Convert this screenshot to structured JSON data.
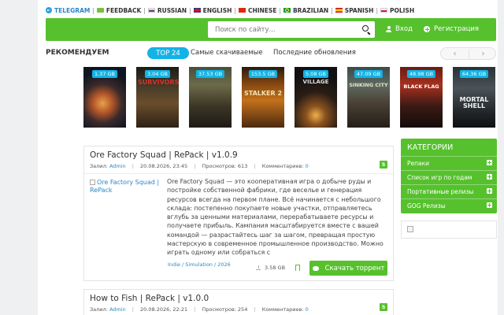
{
  "langbar": {
    "items": [
      {
        "label": "TELEGRAM",
        "icon": "telegram-icon"
      },
      {
        "label": "FEEDBACK",
        "icon": "feedback-icon"
      },
      {
        "label": "RUSSIAN",
        "flag": "ru"
      },
      {
        "label": "ENGLISH",
        "flag": "uk"
      },
      {
        "label": "CHINESE",
        "flag": "cn"
      },
      {
        "label": "BRAZILIAN",
        "flag": "br"
      },
      {
        "label": "SPANISH",
        "flag": "es"
      },
      {
        "label": "POLISH",
        "flag": "pl"
      }
    ],
    "separator": "|"
  },
  "header": {
    "search_placeholder": "Поиск по сайту...",
    "login_label": "Вход",
    "register_label": "Регистрация"
  },
  "recommend": {
    "title": "РЕКОМЕНДУЕМ",
    "tabs": [
      "TOP 24",
      "Самые скачиваемые",
      "Последние обновления"
    ],
    "prev_arrow": "‹",
    "next_arrow": "›"
  },
  "covers": [
    {
      "size": "1.37 GB",
      "title": ""
    },
    {
      "size": "3.04 GB",
      "title": "SURVIVORS"
    },
    {
      "size": "37.53 GB",
      "title": ""
    },
    {
      "size": "153.5 GB",
      "title": "STALKER 2"
    },
    {
      "size": "5.08 GB",
      "title": "VILLAGE"
    },
    {
      "size": "47.09 GB",
      "title": "SINKING CITY"
    },
    {
      "size": "48.98 GB",
      "title": "BLACK FLAG"
    },
    {
      "size": "64.36 GB",
      "title": "MORTAL SHELL"
    }
  ],
  "posts": [
    {
      "title": "Ore Factory Squad | RePack | v1.0.9",
      "badge": "5",
      "meta": {
        "upload_label": "Залил:",
        "uploader": "Admin",
        "date": "20.08.2026, 23:45",
        "views_label": "Просмотров:",
        "views": "613",
        "comments_label": "Комментариев:",
        "comments": "0"
      },
      "image_alt": "Ore Factory Squad | RePack",
      "description": "Ore Factory Squad — это кооперативная игра о добыче руды и постройке собственной фабрики, где веселье и генерация ресурсов всегда на первом плане. Всё начинается с небольшого склада: постепенно покупаете новые участки, отправляетесь вглубь за ценными материалами, перерабатываете ресурсы и получаете прибыль. Кампания масштабируется вместе с вашей командой — разрастайтесь шаг за шагом, превращая простую мастерскую в современное промышленное производство. Можно играть одному или собраться с",
      "tags": "Indie / Simulation / 2026",
      "download_size": "3.58 GB",
      "download_label": "Скачать торрент"
    },
    {
      "title": "How to Fish | RePack | v1.0.0",
      "badge": "5",
      "meta": {
        "upload_label": "Залил:",
        "uploader": "Admin",
        "date": "20.08.2026, 22:21",
        "views_label": "Просмотров:",
        "views": "254",
        "comments_label": "Комментариев:",
        "comments": "0"
      }
    }
  ],
  "sidebar": {
    "categories_title": "КАТЕГОРИИ",
    "categories": [
      "Репаки",
      "Список игр по годам",
      "Портативные релизы",
      "GOG Релизы"
    ]
  },
  "colors": {
    "accent_green": "#56c12d",
    "accent_blue": "#13b3e6",
    "link_blue": "#2b87c7"
  }
}
